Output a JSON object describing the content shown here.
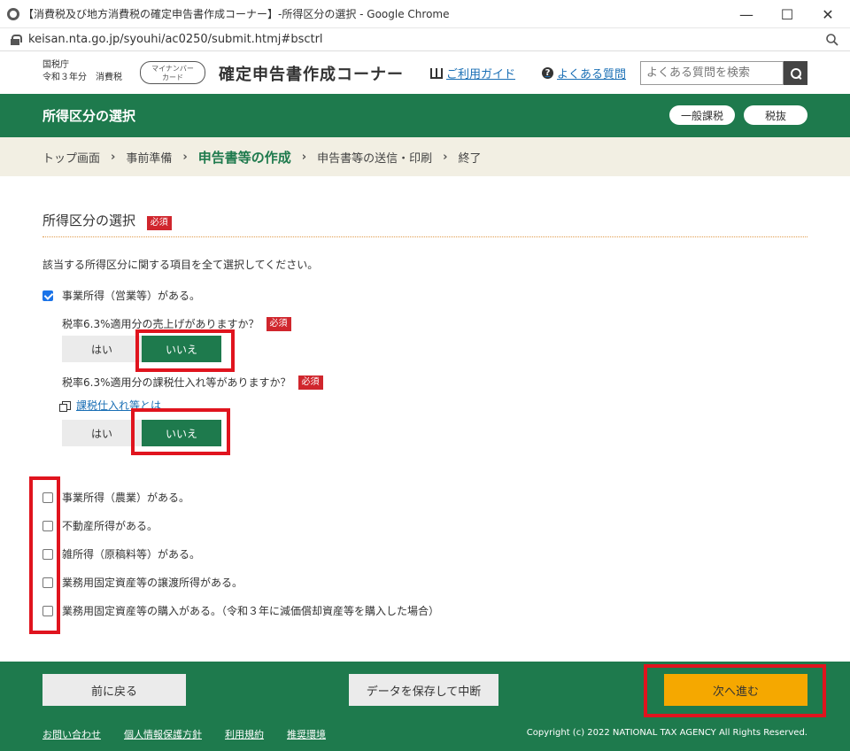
{
  "browser": {
    "title": "【消費税及び地方消費税の確定申告書作成コーナー】-所得区分の選択 - Google Chrome",
    "url": "keisan.nta.go.jp/syouhi/ac0250/submit.htmj#bsctrl"
  },
  "header": {
    "agency": "国税庁",
    "year_line": "令和３年分　消費税",
    "mynumber_label_1": "マイナンバー",
    "mynumber_label_2": "カード",
    "site_title": "確定申告書作成コーナー",
    "guide_link": "ご利用ガイド",
    "faq_link": "よくある質問",
    "search_placeholder": "よくある質問を検索"
  },
  "greenbar": {
    "page_title": "所得区分の選択",
    "tab_general": "一般課税",
    "tab_taxexcl": "税抜"
  },
  "breadcrumb": [
    "トップ画面",
    "事前準備",
    "申告書等の作成",
    "申告書等の送信・印刷",
    "終了"
  ],
  "section": {
    "heading": "所得区分の選択",
    "required": "必須",
    "instruction": "該当する所得区分に関する項目を全て選択してください。"
  },
  "checkbox_business": {
    "label": "事業所得（営業等）がある。",
    "checked": true
  },
  "question1": {
    "text": "税率6.3%適用分の売上げがありますか？",
    "required": "必須",
    "yes": "はい",
    "no": "いいえ",
    "selected": "no"
  },
  "question2": {
    "text": "税率6.3%適用分の課税仕入れ等がありますか？",
    "required": "必須",
    "yes": "はい",
    "no": "いいえ",
    "selected": "no",
    "help_link": "課税仕入れ等とは"
  },
  "other_checkboxes": [
    {
      "label": "事業所得（農業）がある。",
      "checked": false
    },
    {
      "label": "不動産所得がある。",
      "checked": false
    },
    {
      "label": "雑所得（原稿料等）がある。",
      "checked": false
    },
    {
      "label": "業務用固定資産等の譲渡所得がある。",
      "checked": false
    },
    {
      "label": "業務用固定資産等の購入がある。（令和３年に減価償却資産等を購入した場合）",
      "checked": false
    }
  ],
  "footer": {
    "back": "前に戻る",
    "save": "データを保存して中断",
    "next": "次へ進む",
    "links": [
      "お問い合わせ",
      "個人情報保護方針",
      "利用規約",
      "推奨環境"
    ],
    "copyright": "Copyright (c) 2022 NATIONAL TAX AGENCY All Rights Reserved."
  },
  "colors": {
    "green": "#1e7a4d",
    "orange": "#f5a800",
    "red_required": "#d0262d",
    "highlight": "#e0141e"
  }
}
